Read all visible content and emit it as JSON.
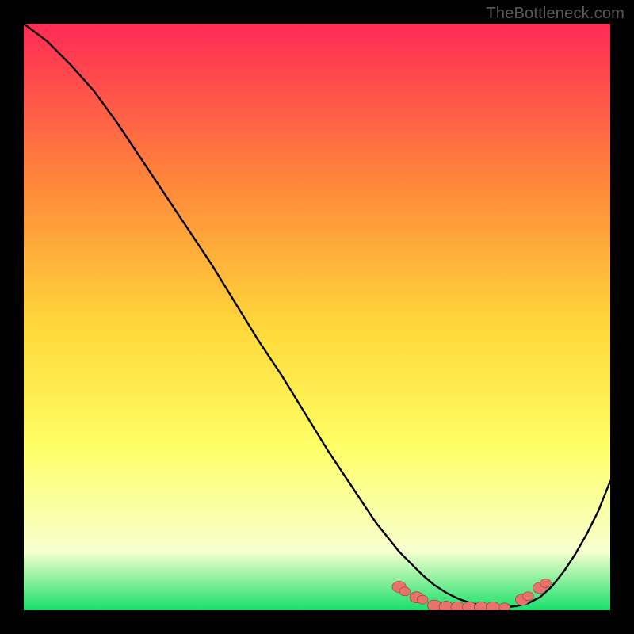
{
  "watermark": "TheBottleneck.com",
  "colors": {
    "bg_black": "#000000",
    "gradient_top": "#ff2a55",
    "gradient_mid_upper": "#ff8a3a",
    "gradient_mid": "#ffd93a",
    "gradient_mid_lower": "#ffff66",
    "gradient_lower": "#f6ffcf",
    "gradient_bottom": "#18e06a",
    "curve": "#000000",
    "marker_fill": "#e9736c",
    "marker_stroke": "#8a3c35"
  },
  "chart_data": {
    "type": "line",
    "title": "",
    "xlabel": "",
    "ylabel": "",
    "xlim": [
      0,
      100
    ],
    "ylim": [
      0,
      100
    ],
    "grid": false,
    "legend": false,
    "axes_visible": false,
    "series": [
      {
        "name": "bottleneck-curve",
        "x": [
          0,
          4,
          8,
          12,
          16,
          20,
          24,
          28,
          32,
          36,
          40,
          44,
          48,
          52,
          56,
          60,
          62,
          64,
          66,
          68,
          70,
          72,
          74,
          76,
          78,
          80,
          82,
          84,
          86,
          88,
          90,
          92,
          94,
          96,
          98,
          100
        ],
        "y": [
          100,
          97,
          93,
          88.5,
          83,
          77,
          71,
          65,
          59,
          52.5,
          46,
          40,
          33.5,
          27,
          21,
          15,
          12.5,
          10,
          8,
          6,
          4.3,
          3,
          2,
          1.3,
          0.8,
          0.5,
          0.5,
          0.7,
          1.2,
          2.2,
          4,
          6.5,
          9.5,
          13,
          17,
          22
        ]
      }
    ],
    "markers": [
      {
        "x": 64,
        "y": 4,
        "size": 1.4
      },
      {
        "x": 65,
        "y": 3.2,
        "size": 1.1
      },
      {
        "x": 67,
        "y": 2.2,
        "size": 1.4
      },
      {
        "x": 68,
        "y": 1.8,
        "size": 1.1
      },
      {
        "x": 70,
        "y": 0.8,
        "size": 1.4
      },
      {
        "x": 72,
        "y": 0.6,
        "size": 1.4
      },
      {
        "x": 74,
        "y": 0.5,
        "size": 1.4
      },
      {
        "x": 76,
        "y": 0.5,
        "size": 1.4
      },
      {
        "x": 78,
        "y": 0.5,
        "size": 1.4
      },
      {
        "x": 80,
        "y": 0.5,
        "size": 1.4
      },
      {
        "x": 82,
        "y": 0.5,
        "size": 1.1
      },
      {
        "x": 85,
        "y": 1.8,
        "size": 1.4
      },
      {
        "x": 86,
        "y": 2.4,
        "size": 1.1
      },
      {
        "x": 88,
        "y": 3.8,
        "size": 1.4
      },
      {
        "x": 89,
        "y": 4.6,
        "size": 1.1
      }
    ]
  }
}
